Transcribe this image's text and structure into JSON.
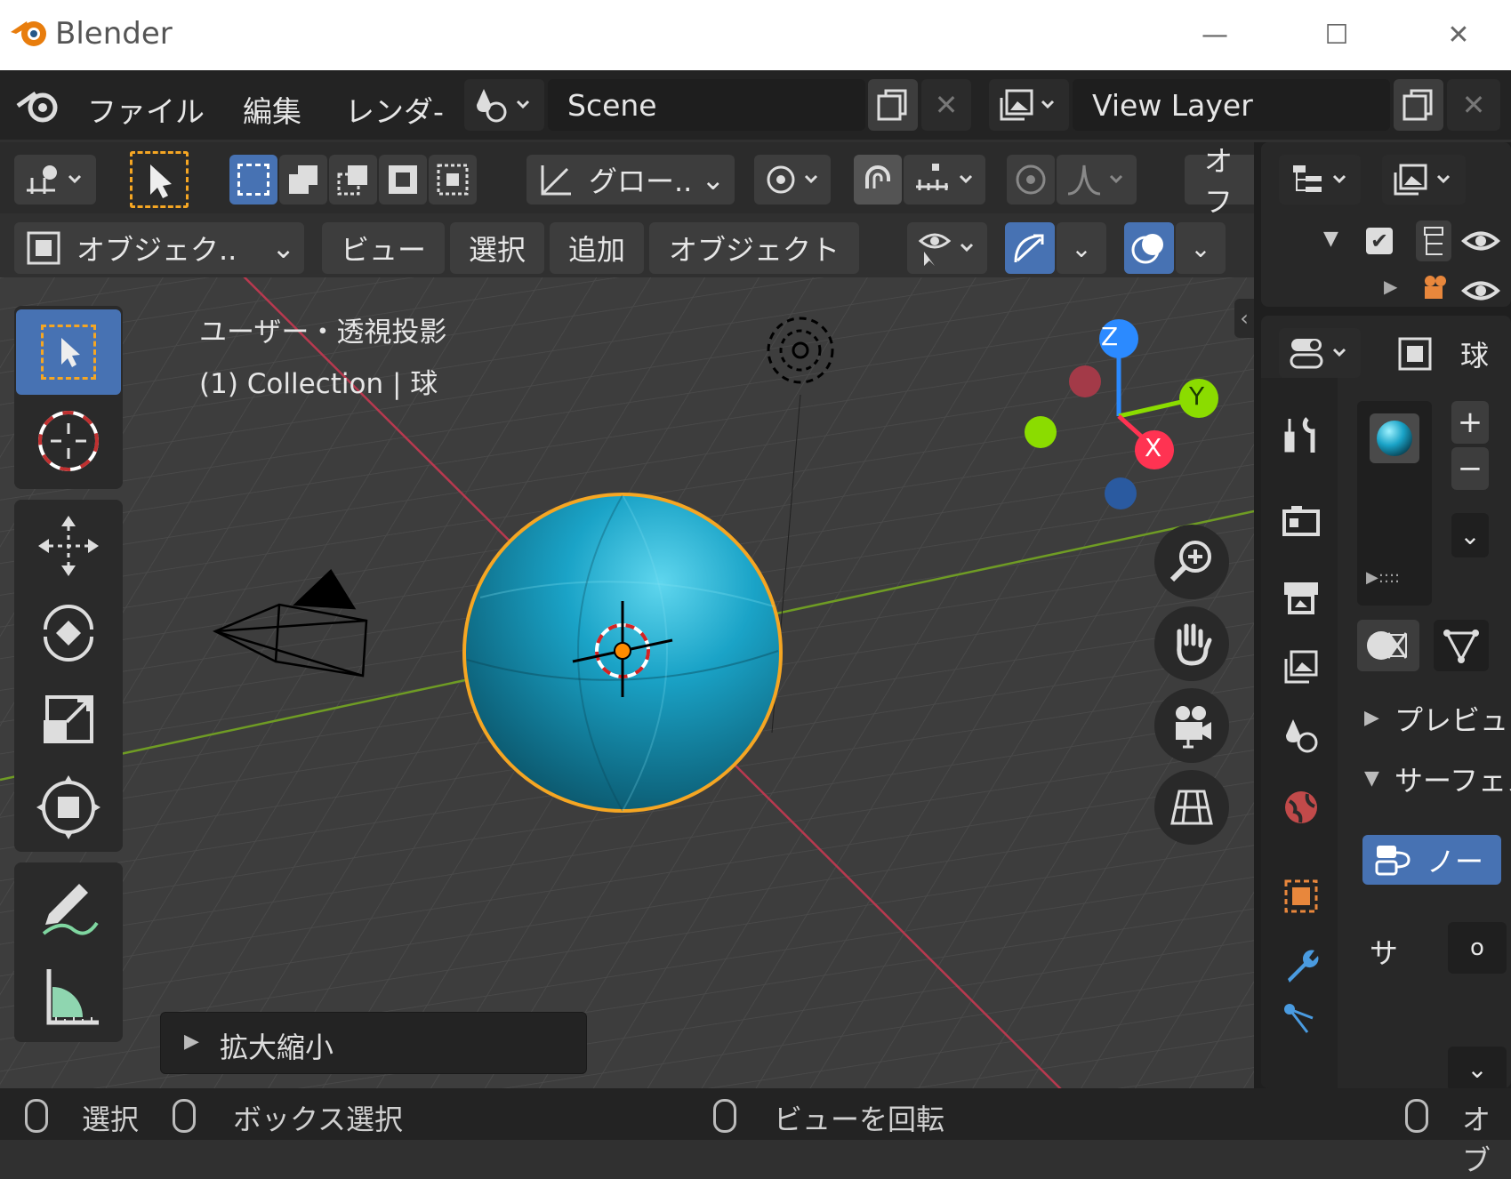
{
  "window": {
    "title": "Blender",
    "controls": [
      "—",
      "☐",
      "✕"
    ]
  },
  "topbar": {
    "menus": [
      "ファイル",
      "編集",
      "レンダ-"
    ],
    "scene": "Scene",
    "view_layer": "View Layer"
  },
  "header": {
    "transform_orientation": "グロー..",
    "overflow_label": "オフ"
  },
  "header2": {
    "mode": "オブジェク..",
    "menus": [
      "ビュー",
      "選択",
      "追加",
      "オブジェクト"
    ]
  },
  "viewport": {
    "view_name": "ユーザー・透視投影",
    "collection_info": "(1) Collection | 球",
    "axes": {
      "z": "Z",
      "y": "Y",
      "x": "X"
    },
    "last_operation": "拡大縮小"
  },
  "properties": {
    "object_name": "球",
    "sections": [
      "プレビュー",
      "サーフェス"
    ],
    "node_button": "ノー",
    "surface_label": "サ",
    "surface_value": "o",
    "slot_dots": "▶::::"
  },
  "statusbar": {
    "select": "選択",
    "box_select": "ボックス選択",
    "rotate_view": "ビューを回転",
    "right_label": "オブ"
  },
  "colors": {
    "accent_blue": "#4772b3",
    "sphere": "#1aa3c7",
    "selection_outline": "#f5a623",
    "axis_x": "#ff3352",
    "axis_y": "#8bdc00",
    "axis_z": "#2b8aff"
  }
}
